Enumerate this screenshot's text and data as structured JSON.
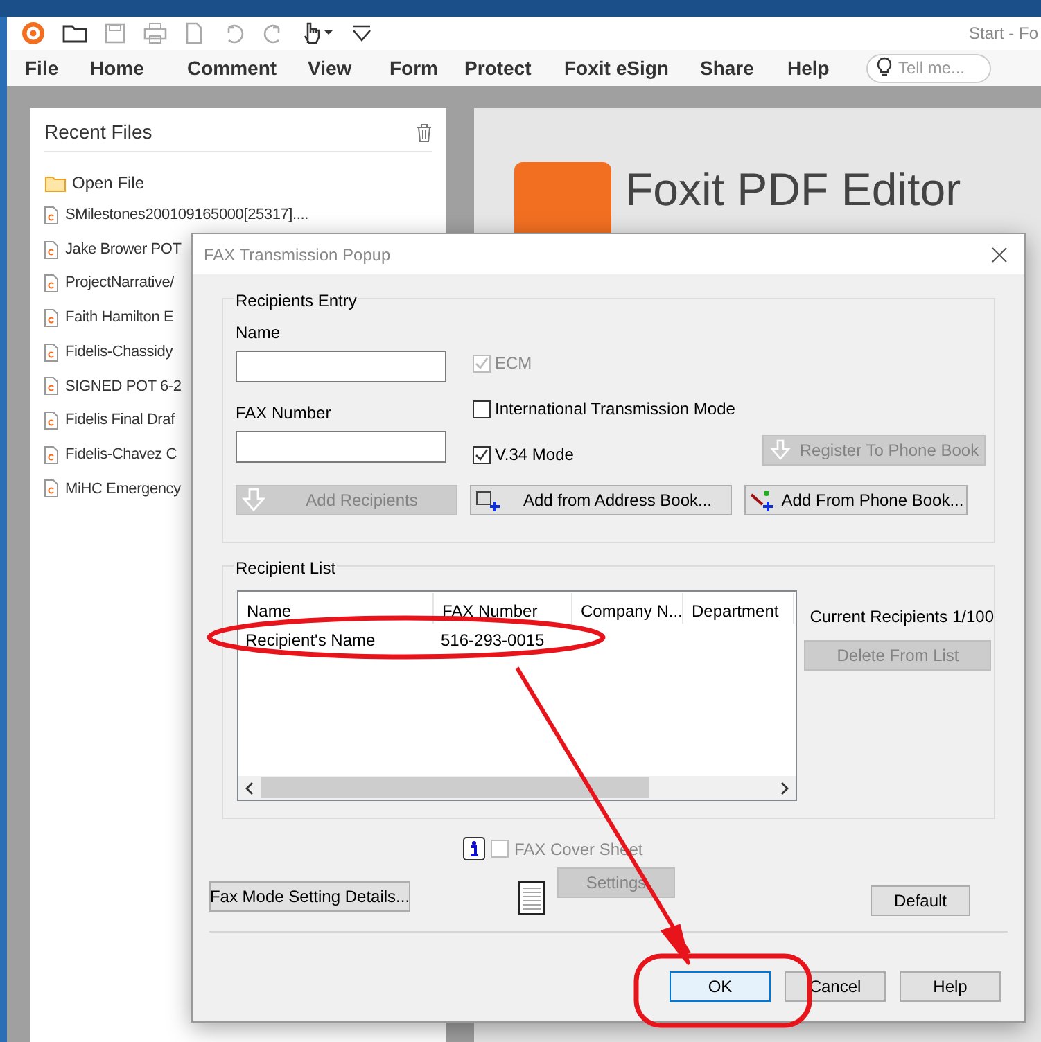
{
  "app": {
    "window_title": "Start - Fo",
    "menu": [
      {
        "label": "File"
      },
      {
        "label": "Home"
      },
      {
        "label": "Comment"
      },
      {
        "label": "View"
      },
      {
        "label": "Form"
      },
      {
        "label": "Protect"
      },
      {
        "label": "Foxit eSign"
      },
      {
        "label": "Share"
      },
      {
        "label": "Help"
      }
    ],
    "tell_me": {
      "placeholder": "Tell me..."
    }
  },
  "recent_files": {
    "title": "Recent Files",
    "open_file": "Open File",
    "files": [
      "SMilestones200109165000[25317]....",
      "Jake Brower POT",
      "ProjectNarrative/",
      "Faith Hamilton E",
      "Fidelis-Chassidy",
      "SIGNED POT 6-2",
      "Fidelis Final Draf",
      "Fidelis-Chavez C",
      "MiHC Emergency"
    ]
  },
  "start_page": {
    "product": "Foxit PDF Editor"
  },
  "dialog": {
    "title": "FAX Transmission Popup",
    "recipients_entry": {
      "legend": "Recipients Entry",
      "name_label": "Name",
      "fax_label": "FAX Number",
      "options": [
        {
          "label": "ECM",
          "checked": true,
          "disabled": true
        },
        {
          "label": "International Transmission Mode",
          "checked": false,
          "disabled": false
        },
        {
          "label": "V.34 Mode",
          "checked": true,
          "disabled": false
        }
      ],
      "register_button": {
        "label": "Register To Phone Book",
        "disabled": true
      },
      "buttons": [
        {
          "label": "Add Recipients",
          "disabled": true
        },
        {
          "label": "Add from Address Book...",
          "disabled": false
        },
        {
          "label": "Add From Phone Book...",
          "disabled": false
        }
      ]
    },
    "recipient_list": {
      "legend": "Recipient List",
      "columns": [
        "Name",
        "FAX Number",
        "Company N...",
        "Department"
      ],
      "rows": [
        [
          "Recipient's Name",
          "516-293-0015",
          "",
          ""
        ]
      ],
      "current": "Current Recipients 1/100",
      "delete_button": {
        "label": "Delete From List",
        "disabled": true
      }
    },
    "cover_sheet": {
      "label": "FAX Cover Sheet",
      "checked": false,
      "disabled": true
    },
    "settings_button": {
      "label": "Settings",
      "disabled": true
    },
    "fax_mode_button": "Fax Mode Setting Details...",
    "default_button": "Default",
    "footer_buttons": [
      {
        "label": "OK",
        "selected": true
      },
      {
        "label": "Cancel",
        "selected": false
      },
      {
        "label": "Help",
        "selected": false
      }
    ]
  }
}
